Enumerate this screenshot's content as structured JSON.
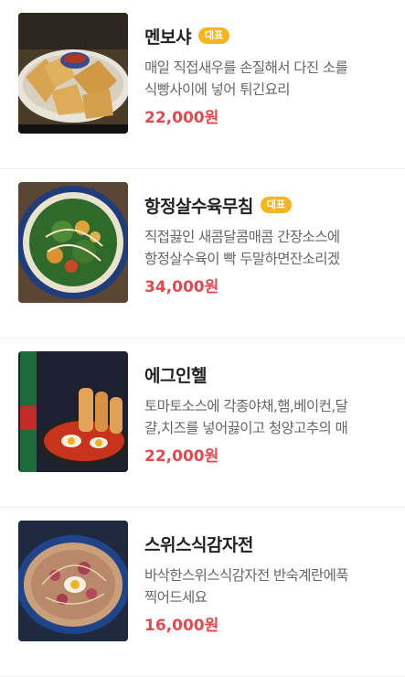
{
  "menu": {
    "items": [
      {
        "name": "멘보샤",
        "badge": "대표",
        "desc_line1": "매일 직접새우를 손질해서 다진 소를",
        "desc_line2": "식빵사이에 넣어 튀긴요리",
        "price": "22,000원",
        "image_icon": "fried-shrimp-toast-photo"
      },
      {
        "name": "항정살수육무침",
        "badge": "대표",
        "desc_line1": "직접끓인 새콤달콤매콤 간장소스에",
        "desc_line2": "항정살수육이 빡 두말하면잔소리겠",
        "price": "34,000원",
        "image_icon": "pork-salad-photo"
      },
      {
        "name": "에그인헬",
        "badge": "",
        "desc_line1": "토마토소스에 각종야채,햄,베이컨,달",
        "desc_line2": "걀,치즈를 넣어끓이고 청양고추의 매",
        "price": "22,000원",
        "image_icon": "egg-in-hell-photo"
      },
      {
        "name": "스위스식감자전",
        "badge": "",
        "desc_line1": "바삭한스위스식감자전 반숙계란에푹",
        "desc_line2": "찍어드세요",
        "price": "16,000원",
        "image_icon": "potato-pancake-photo"
      }
    ]
  }
}
